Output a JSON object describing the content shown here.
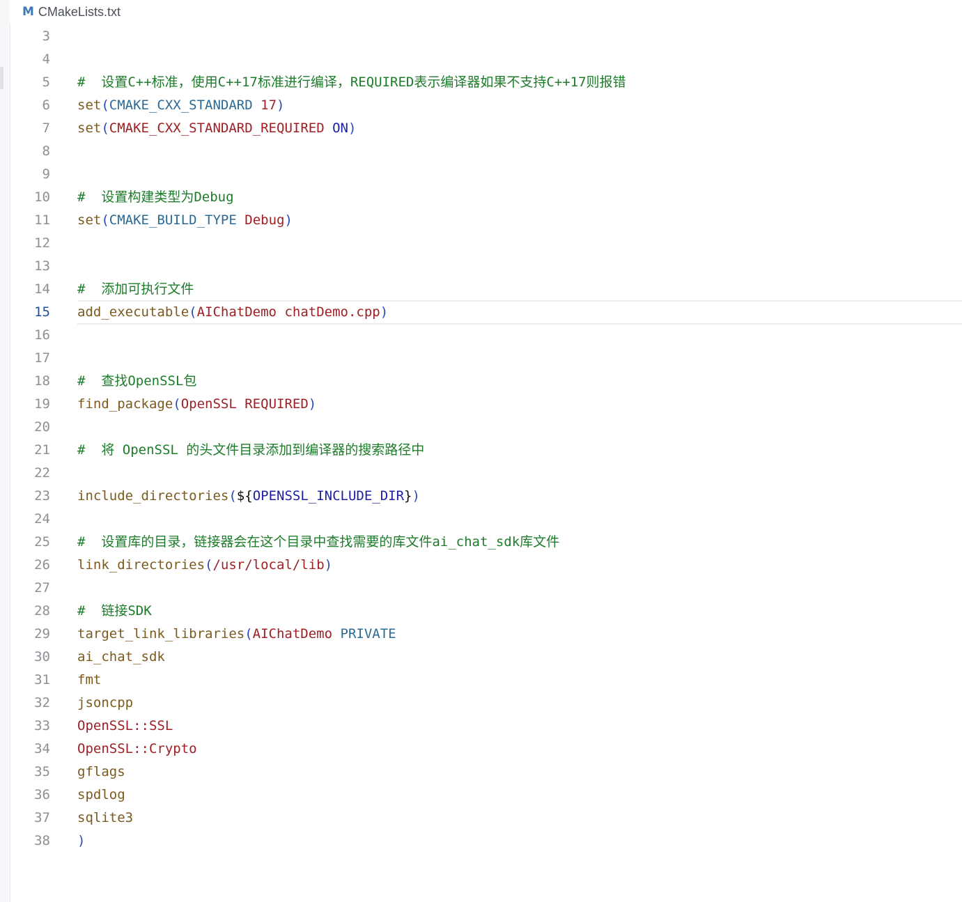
{
  "tab": {
    "icon": "M",
    "filename": "CMakeLists.txt"
  },
  "current_line": 15,
  "lines": [
    {
      "n": "3",
      "tokens": []
    },
    {
      "n": "4",
      "tokens": []
    },
    {
      "n": "5",
      "tokens": [
        {
          "t": "#  设置C++标准，使用C++17标准进行编译，REQUIRED表示编译器如果不支持C++17则报错",
          "c": "cmt"
        }
      ]
    },
    {
      "n": "6",
      "tokens": [
        {
          "t": "set",
          "c": "fn"
        },
        {
          "t": "(",
          "c": "par"
        },
        {
          "t": "CMAKE_CXX_STANDARD",
          "c": "var"
        },
        {
          "t": " ",
          "c": ""
        },
        {
          "t": "17",
          "c": "arg"
        },
        {
          "t": ")",
          "c": "par"
        }
      ]
    },
    {
      "n": "7",
      "tokens": [
        {
          "t": "set",
          "c": "fn"
        },
        {
          "t": "(",
          "c": "par"
        },
        {
          "t": "CMAKE_CXX_STANDARD_REQUIRED",
          "c": "arg"
        },
        {
          "t": " ",
          "c": ""
        },
        {
          "t": "ON",
          "c": "kw"
        },
        {
          "t": ")",
          "c": "par"
        }
      ]
    },
    {
      "n": "8",
      "tokens": []
    },
    {
      "n": "9",
      "tokens": []
    },
    {
      "n": "10",
      "tokens": [
        {
          "t": "#  设置构建类型为Debug",
          "c": "cmt"
        }
      ]
    },
    {
      "n": "11",
      "tokens": [
        {
          "t": "set",
          "c": "fn"
        },
        {
          "t": "(",
          "c": "par"
        },
        {
          "t": "CMAKE_BUILD_TYPE",
          "c": "var"
        },
        {
          "t": " ",
          "c": ""
        },
        {
          "t": "Debug",
          "c": "arg"
        },
        {
          "t": ")",
          "c": "par"
        }
      ]
    },
    {
      "n": "12",
      "tokens": []
    },
    {
      "n": "13",
      "tokens": []
    },
    {
      "n": "14",
      "tokens": [
        {
          "t": "#  添加可执行文件",
          "c": "cmt"
        }
      ]
    },
    {
      "n": "15",
      "tokens": [
        {
          "t": "add_executable",
          "c": "fn"
        },
        {
          "t": "(",
          "c": "par"
        },
        {
          "t": "AIChatDemo chatDemo.cpp",
          "c": "arg"
        },
        {
          "t": ")",
          "c": "par"
        }
      ]
    },
    {
      "n": "16",
      "tokens": []
    },
    {
      "n": "17",
      "tokens": []
    },
    {
      "n": "18",
      "tokens": [
        {
          "t": "#  查找OpenSSL包",
          "c": "cmt"
        }
      ]
    },
    {
      "n": "19",
      "tokens": [
        {
          "t": "find_package",
          "c": "fn"
        },
        {
          "t": "(",
          "c": "par"
        },
        {
          "t": "OpenSSL REQUIRED",
          "c": "arg"
        },
        {
          "t": ")",
          "c": "par"
        }
      ]
    },
    {
      "n": "20",
      "tokens": []
    },
    {
      "n": "21",
      "tokens": [
        {
          "t": "#  将 OpenSSL 的头文件目录添加到编译器的搜索路径中",
          "c": "cmt"
        }
      ]
    },
    {
      "n": "22",
      "tokens": []
    },
    {
      "n": "23",
      "tokens": [
        {
          "t": "include_directories",
          "c": "fn"
        },
        {
          "t": "(",
          "c": "par"
        },
        {
          "t": "${",
          "c": ""
        },
        {
          "t": "OPENSSL_INCLUDE_DIR",
          "c": "kw"
        },
        {
          "t": "}",
          "c": ""
        },
        {
          "t": ")",
          "c": "par"
        }
      ]
    },
    {
      "n": "24",
      "tokens": []
    },
    {
      "n": "25",
      "tokens": [
        {
          "t": "#  设置库的目录，链接器会在这个目录中查找需要的库文件ai_chat_sdk库文件",
          "c": "cmt"
        }
      ]
    },
    {
      "n": "26",
      "tokens": [
        {
          "t": "link_directories",
          "c": "fn"
        },
        {
          "t": "(",
          "c": "par"
        },
        {
          "t": "/usr/local/lib",
          "c": "arg"
        },
        {
          "t": ")",
          "c": "par"
        }
      ]
    },
    {
      "n": "27",
      "tokens": []
    },
    {
      "n": "28",
      "tokens": [
        {
          "t": "#  链接SDK",
          "c": "cmt"
        }
      ]
    },
    {
      "n": "29",
      "tokens": [
        {
          "t": "target_link_libraries",
          "c": "fn"
        },
        {
          "t": "(",
          "c": "par"
        },
        {
          "t": "AIChatDemo",
          "c": "arg"
        },
        {
          "t": " ",
          "c": ""
        },
        {
          "t": "PRIVATE",
          "c": "var"
        }
      ]
    },
    {
      "n": "30",
      "tokens": [
        {
          "t": "ai_chat_sdk",
          "c": "fn"
        }
      ]
    },
    {
      "n": "31",
      "tokens": [
        {
          "t": "fmt",
          "c": "fn"
        }
      ]
    },
    {
      "n": "32",
      "tokens": [
        {
          "t": "jsoncpp",
          "c": "fn"
        }
      ]
    },
    {
      "n": "33",
      "tokens": [
        {
          "t": "OpenSSL::SSL",
          "c": "arg"
        }
      ]
    },
    {
      "n": "34",
      "tokens": [
        {
          "t": "OpenSSL::Crypto",
          "c": "arg"
        }
      ]
    },
    {
      "n": "35",
      "tokens": [
        {
          "t": "gflags",
          "c": "fn"
        }
      ]
    },
    {
      "n": "36",
      "tokens": [
        {
          "t": "spdlog",
          "c": "fn"
        }
      ]
    },
    {
      "n": "37",
      "tokens": [
        {
          "t": "sqlite3",
          "c": "fn"
        }
      ]
    },
    {
      "n": "38",
      "tokens": [
        {
          "t": ")",
          "c": "par"
        }
      ]
    }
  ]
}
